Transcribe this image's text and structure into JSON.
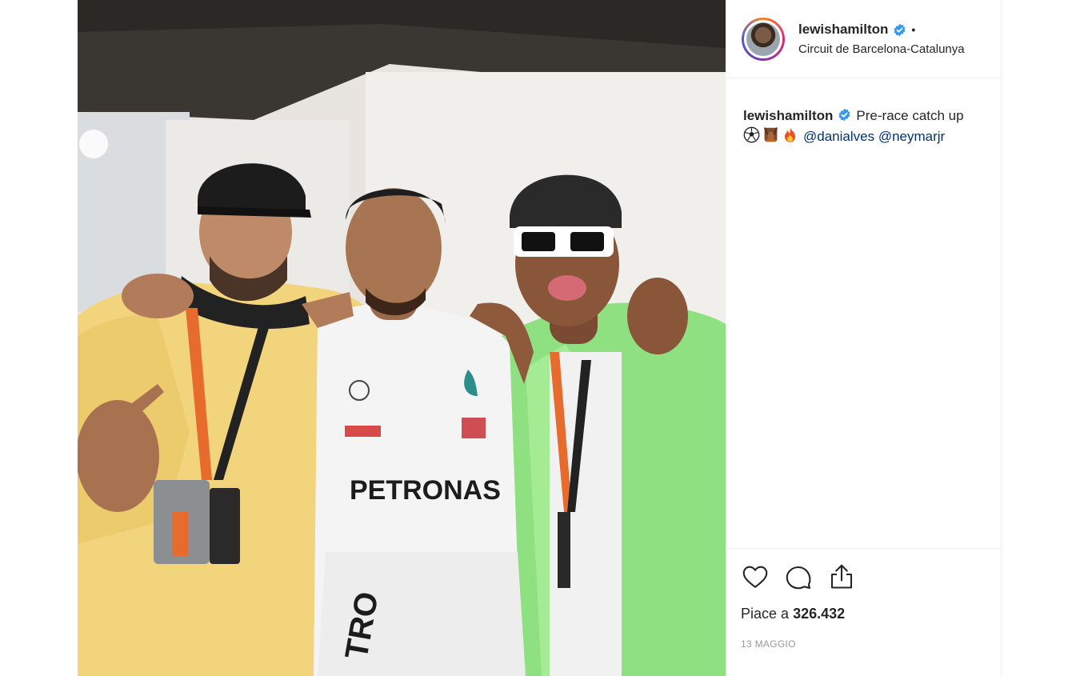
{
  "post": {
    "photo_alt": "Three men posing together at a racing circuit",
    "header": {
      "username": "lewishamilton",
      "dot": "•",
      "location": "Circuit de Barcelona-Catalunya"
    },
    "caption": {
      "username": "lewishamilton",
      "text": "Pre-race catch up",
      "emoji_icons": [
        "soccer-ball-icon",
        "hands-up-icon",
        "fire-icon"
      ],
      "mention_1": "@danialves",
      "mention_2": "@neymarjr"
    },
    "actions": {
      "like_icon": "heart-icon",
      "comment_icon": "comment-bubble-icon",
      "share_icon": "share-upload-icon"
    },
    "likes": {
      "prefix": "Piace a",
      "count": "326.432"
    },
    "date": "13 MAGGIO",
    "colors": {
      "verified": "#3897f0",
      "mention": "#003569",
      "text": "#262626",
      "muted": "#999999"
    }
  }
}
